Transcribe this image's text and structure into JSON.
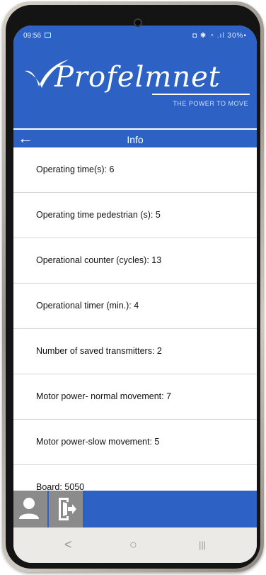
{
  "status_bar": {
    "time": "09:56",
    "right_icons": "◘ ✱ ◔ .ıl 30%▪"
  },
  "header": {
    "brand": "Profelmnet",
    "tagline": "THE POWER TO MOVE"
  },
  "nav": {
    "back_icon": "arrow-left",
    "title": "Info"
  },
  "info_items": [
    {
      "label": "Operating time(s): 6"
    },
    {
      "label": "Operating time pedestrian (s): 5"
    },
    {
      "label": "Operational counter (cycles): 13"
    },
    {
      "label": "Operational timer (min.): 4"
    },
    {
      "label": "Number of saved transmitters: 2"
    },
    {
      "label": "Motor power- normal movement: 7"
    },
    {
      "label": "Motor power-slow  movement: 5"
    },
    {
      "label": "Board: 5050"
    }
  ],
  "bottom_bar": {
    "buttons": [
      "user-icon",
      "logout-icon"
    ]
  },
  "system_nav": {
    "back": "<",
    "home": "○",
    "recents": "|||"
  },
  "colors": {
    "brand_blue": "#2d62c4",
    "button_gray": "#8b8b8b",
    "divider": "#d7d7d7"
  }
}
